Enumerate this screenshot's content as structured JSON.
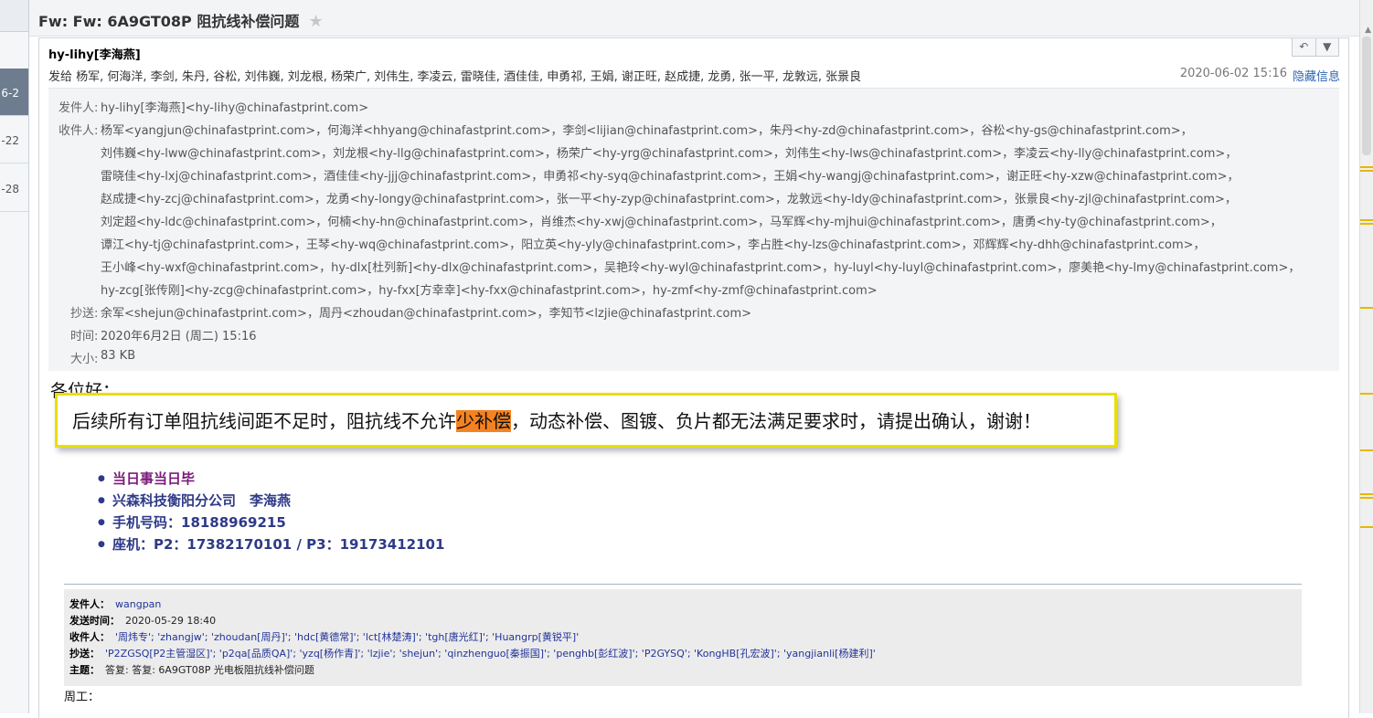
{
  "left_list": {
    "dates": [
      "6-2",
      "-22",
      "-28"
    ]
  },
  "email": {
    "subject": "Fw: Fw: 6A9GT08P  阻抗线补偿问题",
    "sender_name": "hy-lihy[李海燕]",
    "to_summary": "发给 杨军, 何海洋, 李剑, 朱丹, 谷松, 刘伟巍, 刘龙根, 杨荣广, 刘伟生, 李凌云, 雷晓佳, 酒佳佳, 申勇祁, 王娟, 谢正旺, 赵成捷, 龙勇, 张一平, 龙敦远, 张景良",
    "date": "2020-06-02 15:16",
    "hide_info": "隐藏信息",
    "reply_icon": "reply-icon",
    "more_icon": "chevron-down-icon"
  },
  "details": {
    "from_label": "发件人:",
    "from_value": "hy-lihy[李海燕]<hy-lihy@chinafastprint.com>",
    "to_label": "收件人:",
    "to_lines": [
      "杨军<yangjun@chinafastprint.com>，何海洋<hhyang@chinafastprint.com>，李剑<lijian@chinafastprint.com>，朱丹<hy-zd@chinafastprint.com>，谷松<hy-gs@chinafastprint.com>，",
      "刘伟巍<hy-lww@chinafastprint.com>，刘龙根<hy-llg@chinafastprint.com>，杨荣广<hy-yrg@chinafastprint.com>，刘伟生<hy-lws@chinafastprint.com>，李凌云<hy-lly@chinafastprint.com>，",
      "雷晓佳<hy-lxj@chinafastprint.com>，酒佳佳<hy-jjj@chinafastprint.com>，申勇祁<hy-syq@chinafastprint.com>，王娟<hy-wangj@chinafastprint.com>，谢正旺<hy-xzw@chinafastprint.com>，",
      "赵成捷<hy-zcj@chinafastprint.com>，龙勇<hy-longy@chinafastprint.com>，张一平<hy-zyp@chinafastprint.com>，龙敦远<hy-ldy@chinafastprint.com>，张景良<hy-zjl@chinafastprint.com>，",
      "刘定超<hy-ldc@chinafastprint.com>，何楠<hy-hn@chinafastprint.com>，肖维杰<hy-xwj@chinafastprint.com>，马军辉<hy-mjhui@chinafastprint.com>，唐勇<hy-ty@chinafastprint.com>，",
      "谭江<hy-tj@chinafastprint.com>，王琴<hy-wq@chinafastprint.com>，阳立英<hy-yly@chinafastprint.com>，李占胜<hy-lzs@chinafastprint.com>，邓辉辉<hy-dhh@chinafastprint.com>，",
      "王小峰<hy-wxf@chinafastprint.com>，hy-dlx[杜列新]<hy-dlx@chinafastprint.com>，吴艳玲<hy-wyl@chinafastprint.com>，hy-luyl<hy-luyl@chinafastprint.com>，廖美艳<hy-lmy@chinafastprint.com>，",
      "hy-zcg[张传刚]<hy-zcg@chinafastprint.com>，hy-fxx[方幸幸]<hy-fxx@chinafastprint.com>，hy-zmf<hy-zmf@chinafastprint.com>"
    ],
    "cc_label": "抄送:",
    "cc_value": "余军<shejun@chinafastprint.com>，周丹<zhoudan@chinafastprint.com>，李知节<lzjie@chinafastprint.com>",
    "time_label": "时间:",
    "time_value": "2020年6月2日 (周二) 15:16",
    "size_label": "大小:",
    "size_value": "83 KB"
  },
  "body": {
    "greeting": "各位好：",
    "notice_before": "后续所有订单阻抗线间距不足时，阻抗线不允许",
    "notice_highlight": "少补偿",
    "notice_after": "，动态补偿、图镀、负片都无法满足要求时，请提出确认，谢谢！",
    "signature": [
      "当日事当日毕",
      "兴森科技衡阳分公司　李海燕",
      "手机号码：18188969215",
      "座机：P2：17382170101 / P3：19173412101"
    ]
  },
  "quoted": {
    "from_label": "发件人：",
    "from_value": "wangpan",
    "sent_label": "发送时间：",
    "sent_value": "2020-05-29 18:40",
    "to_label": "收件人：",
    "to_value": "'周炜专'; 'zhangjw'; 'zhoudan[周丹]'; 'hdc[黄德常]'; 'lct[林楚涛]'; 'tgh[唐光红]'; 'Huangrp[黄锐平]'",
    "cc_label": "抄送：",
    "cc_value": "'P2ZGSQ[P2主管湿区]'; 'p2qa[品质QA]'; 'yzq[杨作青]'; 'lzjie'; 'shejun'; 'qinzhenguo[秦振国]'; 'penghb[彭红波]'; 'P2GYSQ'; 'KongHB[孔宏波]'; 'yangjianli[杨建利]'",
    "subject_label": "主题：",
    "subject_value": "答复: 答复: 6A9GT08P 光电板阻抗线补偿问题",
    "closing": "周工："
  }
}
